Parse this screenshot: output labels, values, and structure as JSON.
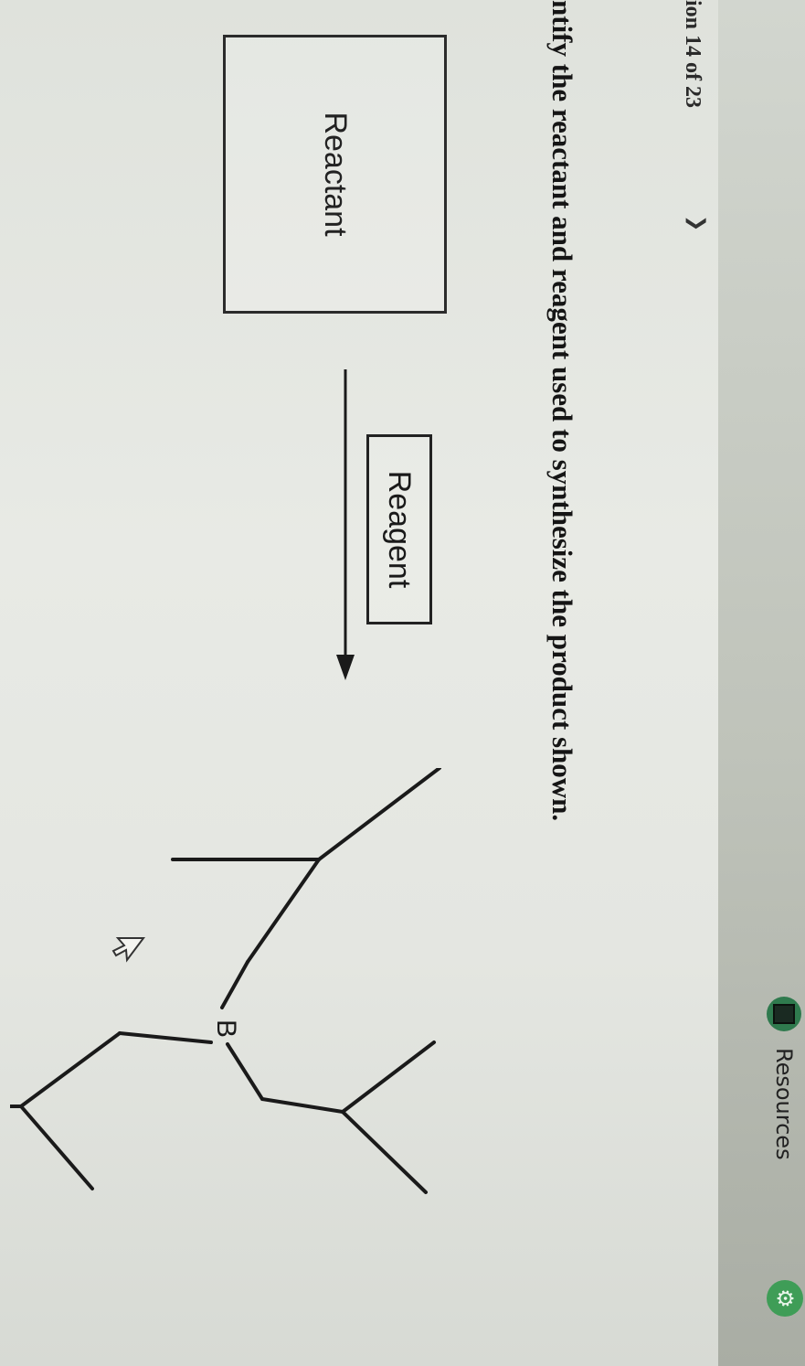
{
  "header": {
    "question_nav": "ion 14 of 23",
    "next_icon": "chevron-right-icon",
    "resources_label": "Resources",
    "resources_icon": "book-icon",
    "settings_icon": "gear-icon"
  },
  "question": {
    "instruction": "ntify the reactant and reagent used to synthesize the product shown."
  },
  "reaction": {
    "reactant_label": "Reactant",
    "reagent_label": "Reagent",
    "arrow_icon": "reaction-arrow-icon",
    "product_atom_label": "B"
  },
  "colors": {
    "accent_green": "#3f9d57",
    "text": "#151515"
  }
}
